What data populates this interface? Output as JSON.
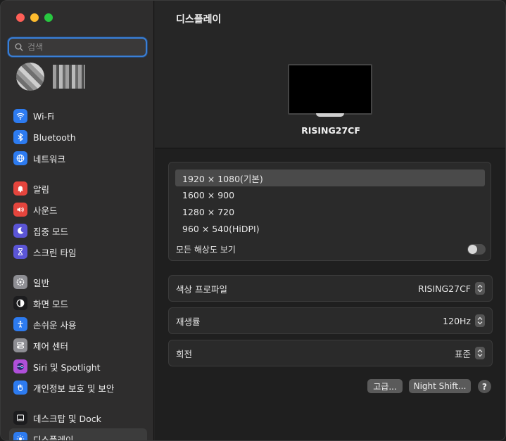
{
  "search": {
    "placeholder": "검색"
  },
  "sidebar": {
    "groups": [
      [
        {
          "label": "Wi-Fi",
          "icon": "wifi-icon",
          "color": "#2d7bf0"
        },
        {
          "label": "Bluetooth",
          "icon": "bluetooth-icon",
          "color": "#2d7bf0"
        },
        {
          "label": "네트워크",
          "icon": "network-globe-icon",
          "color": "#2d7bf0"
        }
      ],
      [
        {
          "label": "알림",
          "icon": "bell-icon",
          "color": "#e5453d"
        },
        {
          "label": "사운드",
          "icon": "speaker-icon",
          "color": "#e5453d"
        },
        {
          "label": "집중 모드",
          "icon": "moon-icon",
          "color": "#5b55d6"
        },
        {
          "label": "스크린 타임",
          "icon": "hourglass-icon",
          "color": "#5b55d6"
        }
      ],
      [
        {
          "label": "일반",
          "icon": "gear-icon",
          "color": "#8e8e93"
        },
        {
          "label": "화면 모드",
          "icon": "appearance-icon",
          "color": "#1c1c1e"
        },
        {
          "label": "손쉬운 사용",
          "icon": "accessibility-icon",
          "color": "#2d7bf0"
        },
        {
          "label": "제어 센터",
          "icon": "control-center-icon",
          "color": "#8e8e93"
        },
        {
          "label": "Siri 및 Spotlight",
          "icon": "siri-icon",
          "color": "#b04fd9"
        },
        {
          "label": "개인정보 보호 및 보안",
          "icon": "hand-icon",
          "color": "#2d7bf0"
        }
      ],
      [
        {
          "label": "데스크탑 및 Dock",
          "icon": "dock-icon",
          "color": "#1c1c1e"
        },
        {
          "label": "디스플레이",
          "icon": "sun-icon",
          "color": "#2d7bf0",
          "active": true
        }
      ]
    ]
  },
  "main": {
    "title": "디스플레이",
    "monitor_name": "RISING27CF",
    "resolutions": [
      {
        "label": "1920 × 1080(기본)",
        "selected": true
      },
      {
        "label": "1600 × 900"
      },
      {
        "label": "1280 × 720"
      },
      {
        "label": "960 × 540(HiDPI)"
      }
    ],
    "show_all_label": "모든 해상도 보기",
    "color_profile": {
      "label": "색상 프로파일",
      "value": "RISING27CF"
    },
    "refresh_rate": {
      "label": "재생률",
      "value": "120Hz"
    },
    "rotation": {
      "label": "회전",
      "value": "표준"
    },
    "advanced_button": "고급...",
    "night_shift_button": "Night Shift...",
    "help_label": "?"
  }
}
